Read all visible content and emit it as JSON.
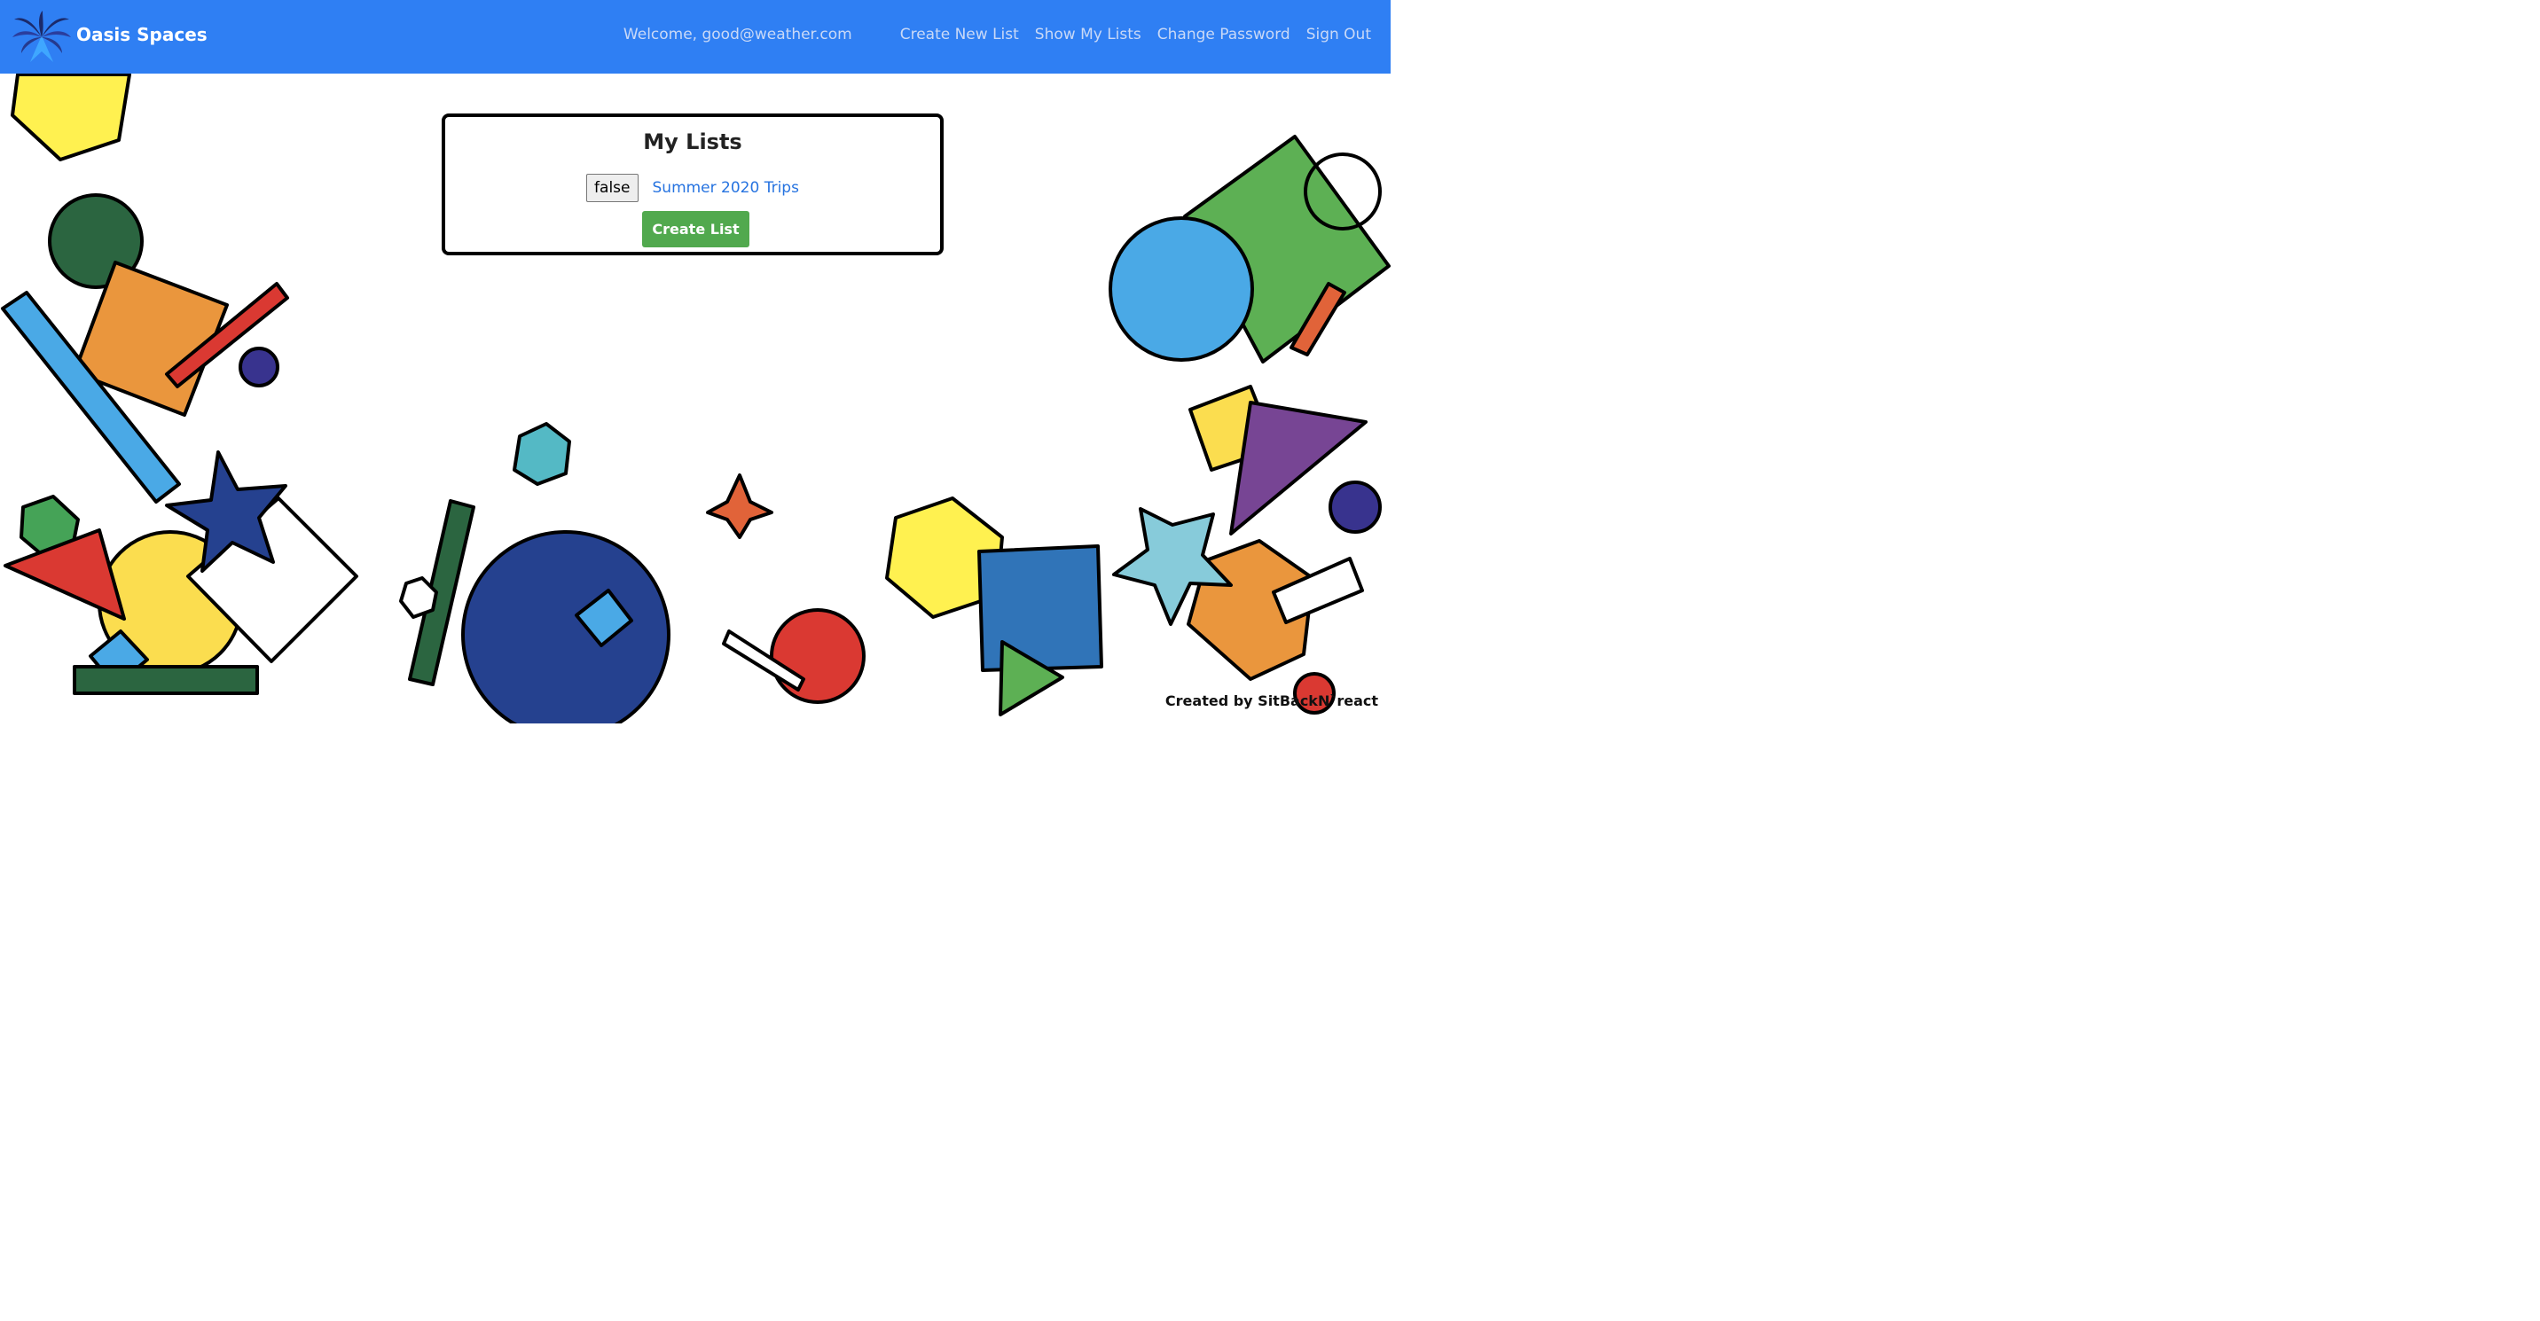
{
  "colors": {
    "navbar": "#2f7ff3",
    "brand_text": "#ffffff",
    "nav_text": "#c9d9f7",
    "link": "#2673e0",
    "create_button": "#51a94e"
  },
  "navbar": {
    "brand_name": "Oasis Spaces",
    "logo_icon": "palm-tree-icon",
    "welcome": "Welcome, good@weather.com",
    "links": [
      "Create New List",
      "Show My Lists",
      "Change Password",
      "Sign Out"
    ]
  },
  "card": {
    "title": "My Lists",
    "toggle_label": "false",
    "list_link": "Summer 2020 Trips",
    "create_button": "Create List"
  },
  "footer": {
    "credit": "Created by SitBackN`react"
  }
}
